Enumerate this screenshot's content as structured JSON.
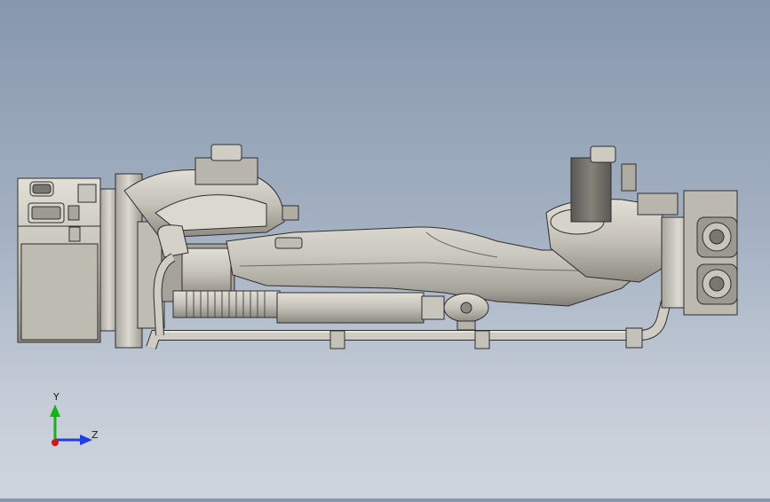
{
  "viewport": {
    "colors": {
      "bg_top": "#8797ac",
      "bg_bottom": "#cfd5de",
      "metal": "#c9c6bd",
      "metal_dark": "#8c8980",
      "edge": "#2e2e2e",
      "dark_block": "#6e6c66"
    }
  },
  "triad": {
    "y_label": "Y",
    "z_label": "Z",
    "colors": {
      "y": "#17b217",
      "z": "#1f3fe0",
      "x": "#d41818"
    }
  }
}
